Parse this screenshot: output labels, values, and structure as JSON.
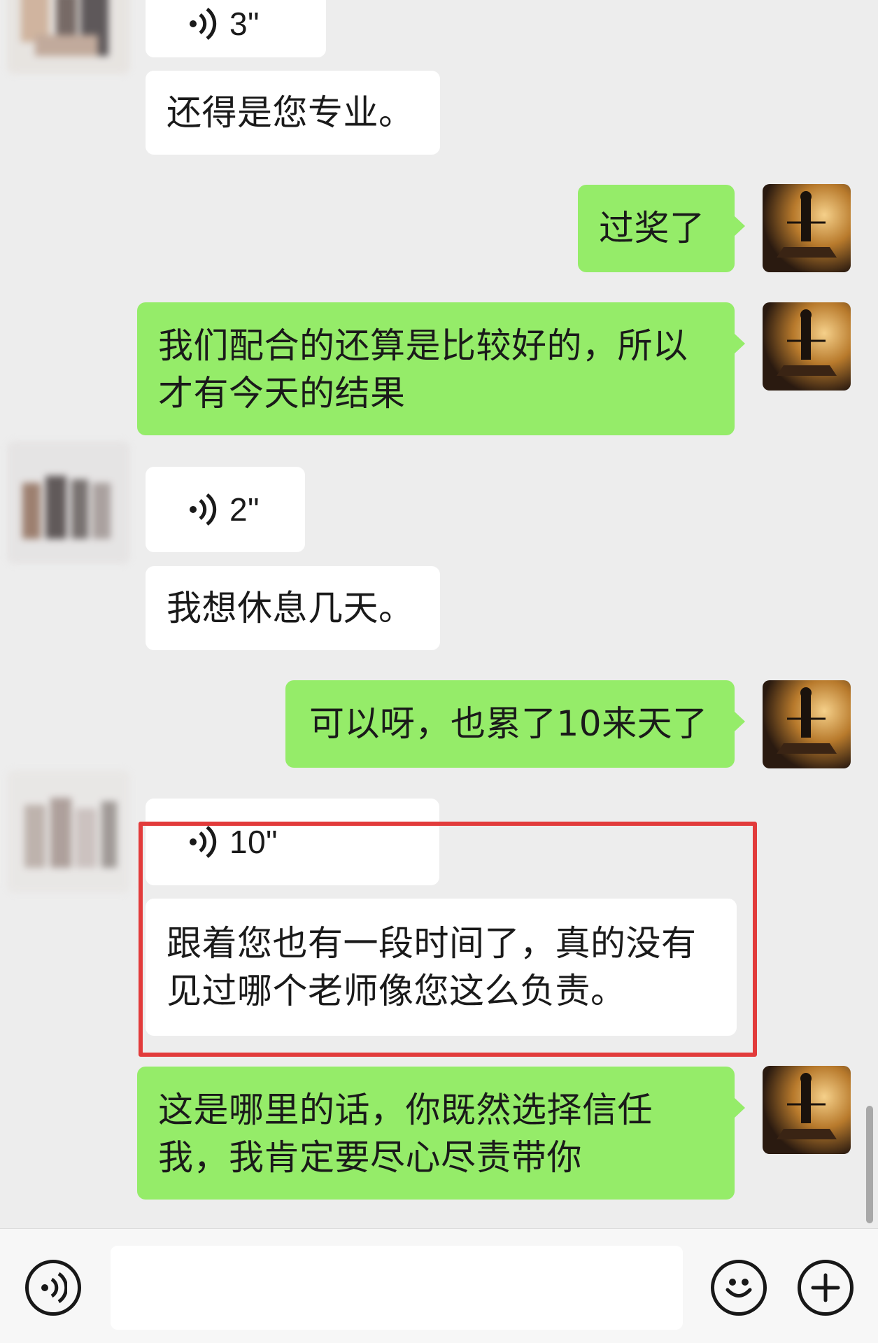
{
  "messages": [
    {
      "side": "in",
      "type": "voice",
      "duration": "3\""
    },
    {
      "side": "in",
      "type": "text",
      "text": "还得是您专业。"
    },
    {
      "side": "out",
      "type": "text",
      "text": "过奖了"
    },
    {
      "side": "out",
      "type": "text",
      "text": "我们配合的还算是比较好的，所以才有今天的结果"
    },
    {
      "side": "in",
      "type": "voice",
      "duration": "2\""
    },
    {
      "side": "in",
      "type": "text",
      "text": "我想休息几天。"
    },
    {
      "side": "out",
      "type": "text",
      "text": "可以呀，也累了10来天了"
    },
    {
      "side": "in",
      "type": "voice",
      "duration": "10\""
    },
    {
      "side": "in",
      "type": "text",
      "text": "跟着您也有一段时间了，真的没有见过哪个老师像您这么负责。"
    },
    {
      "side": "out",
      "type": "text",
      "text": "这是哪里的话，你既然选择信任我，我肯定要尽心尽责带你"
    }
  ],
  "colors": {
    "background": "#ededed",
    "incoming_bubble": "#ffffff",
    "outgoing_bubble": "#95ec69",
    "highlight_box": "#e23b3b"
  },
  "input_bar": {
    "left_icon": "voice-input-icon",
    "right_icons": [
      "emoji-icon",
      "plus-icon"
    ]
  }
}
